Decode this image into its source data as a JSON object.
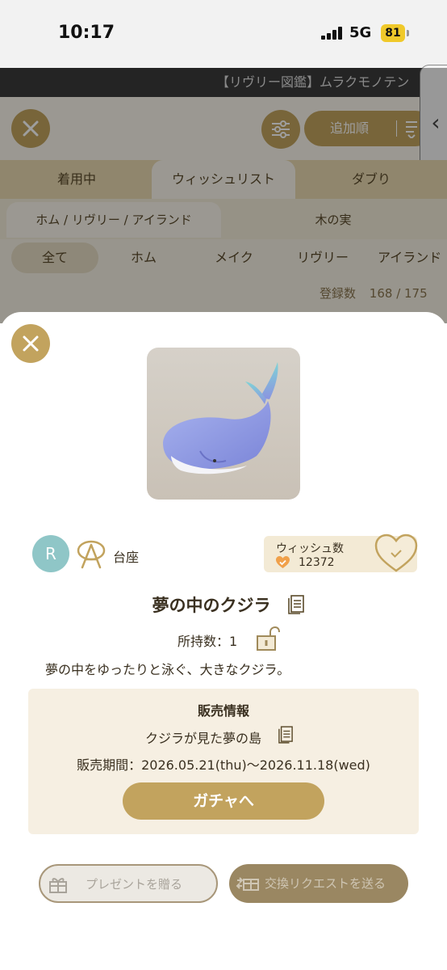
{
  "status_bar": {
    "time": "10:17",
    "network": "5G",
    "battery": "81"
  },
  "banner": {
    "text": "【リヴリー図鑑】ムラクモノテン"
  },
  "toolbar": {
    "sort_label": "追加順"
  },
  "tabs_primary": [
    {
      "label": "着用中",
      "active": false
    },
    {
      "label": "ウィッシュリスト",
      "active": true
    },
    {
      "label": "ダブり",
      "active": false
    }
  ],
  "tabs_secondary": [
    {
      "label": "ホム / リヴリー / アイランド",
      "active": true
    },
    {
      "label": "木の実",
      "active": false
    }
  ],
  "filters": [
    {
      "label": "全て",
      "active": true
    },
    {
      "label": "ホム",
      "active": false
    },
    {
      "label": "メイク",
      "active": false
    },
    {
      "label": "リヴリー",
      "active": false
    },
    {
      "label": "アイランド",
      "active": false
    }
  ],
  "registration": {
    "label": "登録数",
    "value": "168 / 175"
  },
  "item": {
    "rarity": "R",
    "category": "台座",
    "wish_label": "ウィッシュ数",
    "wish_count": "12372",
    "name": "夢の中のクジラ",
    "owned": "所持数：1",
    "description": "夢の中をゆったりと泳ぐ、大きなクジラ。"
  },
  "sale": {
    "heading": "販売情報",
    "name": "クジラが見た夢の島",
    "period": "販売期間：2026.05.21(thu)〜2026.11.18(wed)",
    "gacha_button": "ガチャへ"
  },
  "actions": {
    "present": "プレゼントを贈る",
    "trade": "交換リクエストを送る"
  },
  "colors": {
    "accent": "#c2a35e",
    "rarity": "#8fc6c7",
    "heart": "#f0a04a",
    "trade": "#9a8762"
  }
}
